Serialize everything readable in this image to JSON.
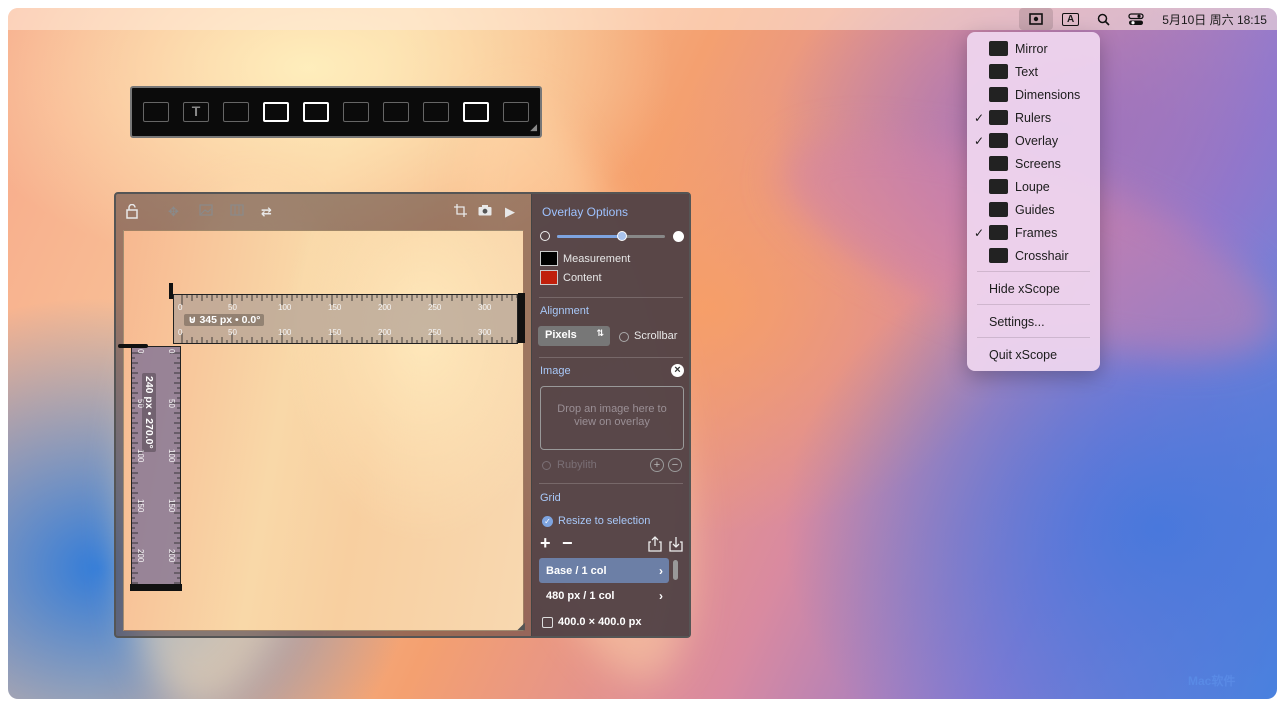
{
  "menubar": {
    "xscope_icon": "xscope-icon",
    "input_label": "A",
    "search_icon": "search-icon",
    "control_center_icon": "control-center-icon",
    "clock": "5月10日 周六  18:15"
  },
  "menu": {
    "tools": [
      {
        "label": "Mirror",
        "checked": false,
        "icon": "mirror-icon"
      },
      {
        "label": "Text",
        "checked": false,
        "icon": "text-icon"
      },
      {
        "label": "Dimensions",
        "checked": false,
        "icon": "dimensions-icon"
      },
      {
        "label": "Rulers",
        "checked": true,
        "icon": "rulers-icon"
      },
      {
        "label": "Overlay",
        "checked": true,
        "icon": "overlay-icon"
      },
      {
        "label": "Screens",
        "checked": false,
        "icon": "screens-icon"
      },
      {
        "label": "Loupe",
        "checked": false,
        "icon": "loupe-icon"
      },
      {
        "label": "Guides",
        "checked": false,
        "icon": "guides-icon"
      },
      {
        "label": "Frames",
        "checked": true,
        "icon": "frames-icon"
      },
      {
        "label": "Crosshair",
        "checked": false,
        "icon": "crosshair-icon"
      }
    ],
    "hide": "Hide xScope",
    "settings": "Settings...",
    "quit": "Quit xScope",
    "checkmark": "✓"
  },
  "palette": {
    "tools": [
      {
        "name": "mirror",
        "on": false
      },
      {
        "name": "text",
        "on": false,
        "glyph": "T"
      },
      {
        "name": "dimensions",
        "on": false
      },
      {
        "name": "rulers",
        "on": true
      },
      {
        "name": "overlay",
        "on": true
      },
      {
        "name": "screens",
        "on": false
      },
      {
        "name": "loupe",
        "on": false
      },
      {
        "name": "guides",
        "on": false
      },
      {
        "name": "frames",
        "on": true
      },
      {
        "name": "crosshair",
        "on": false
      }
    ]
  },
  "overlay": {
    "options_title": "Overlay Options",
    "measurement_label": "Measurement",
    "measurement_color": "#000000",
    "content_label": "Content",
    "content_color": "#c0200c",
    "opacity": 0.6,
    "alignment_label": "Alignment",
    "alignment_value": "Pixels",
    "scrollbar_label": "Scrollbar",
    "image_label": "Image",
    "image_placeholder": "Drop an image here to view on overlay",
    "rubylith_label": "Rubylith",
    "grid_label": "Grid",
    "resize_label": "Resize to selection",
    "grid_items": [
      "Base / 1 col",
      "480 px / 1 col"
    ],
    "size_readout": "400.0 × 400.0 px"
  },
  "rulers": {
    "horizontal_readout": "345 px • 0.0°",
    "vertical_readout": "240 px • 270.0°",
    "h_ticks": [
      "0",
      "50",
      "100",
      "150",
      "200",
      "250",
      "300"
    ],
    "v_ticks": [
      "0",
      "50",
      "100",
      "150",
      "200"
    ]
  },
  "watermark": "Mac软件"
}
